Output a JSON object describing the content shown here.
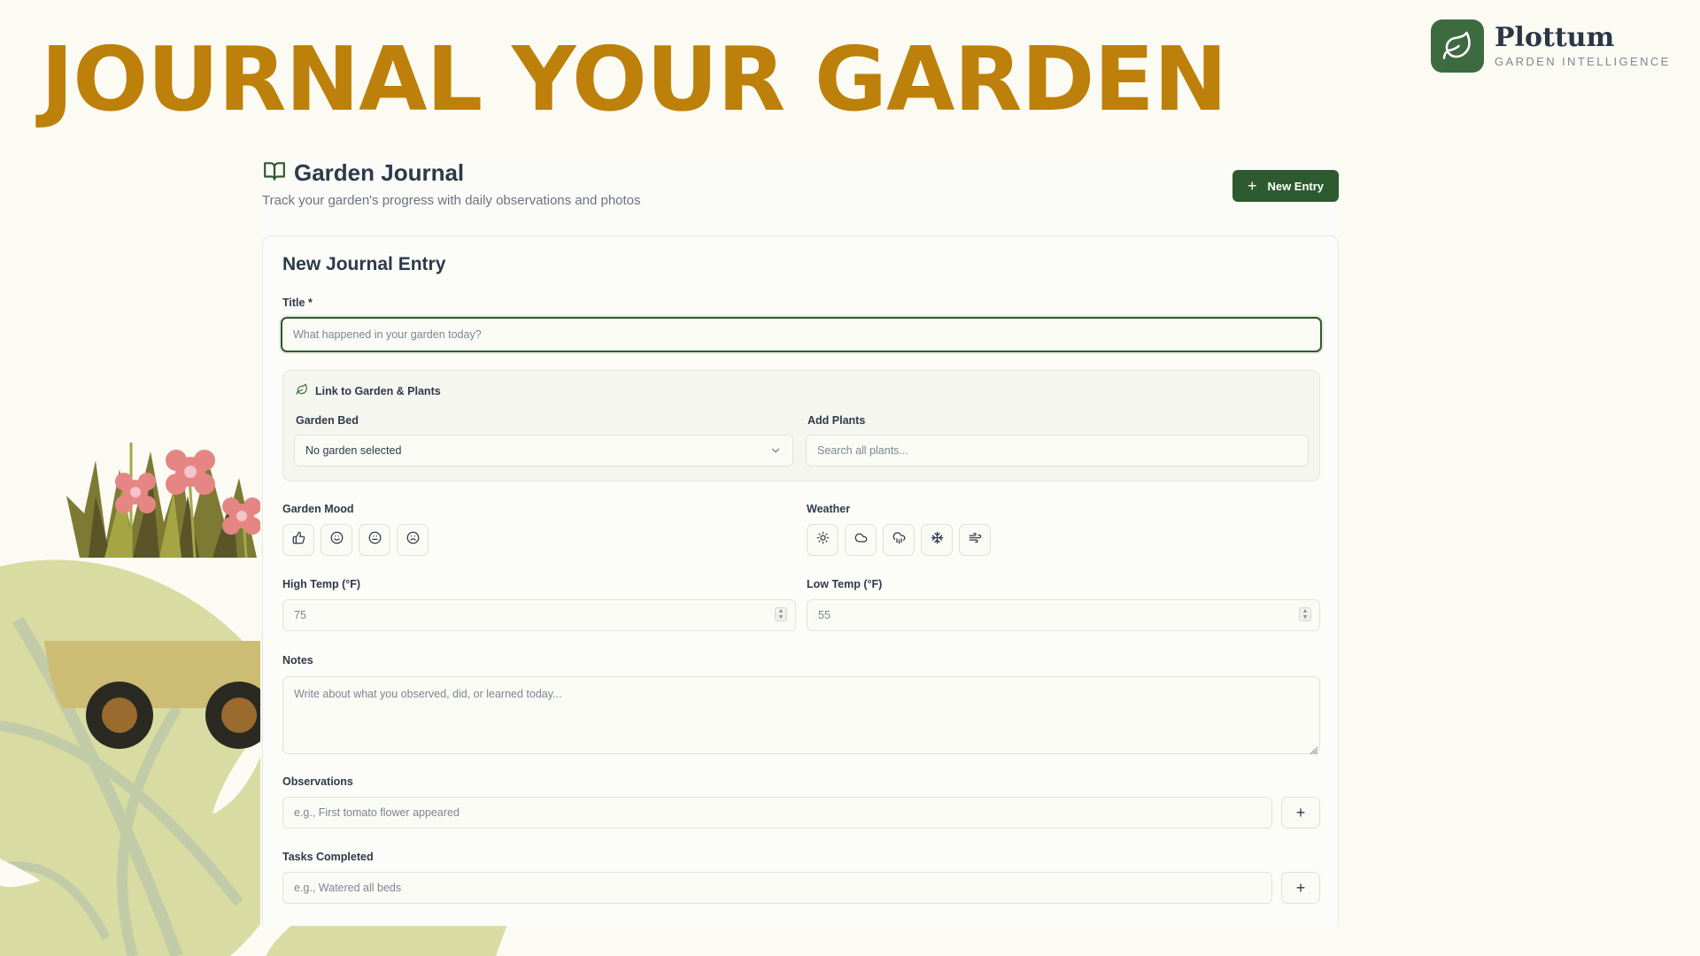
{
  "headline": "JOURNAL YOUR GARDEN",
  "brand": {
    "name": "Plottum",
    "tagline": "GARDEN INTELLIGENCE",
    "color": "#3e6a3f"
  },
  "colors": {
    "accent": "#bd800a",
    "primary": "#2e5a30",
    "background": "#fbfbf3"
  },
  "header": {
    "title": "Garden Journal",
    "subtitle": "Track your garden's progress with daily observations and photos",
    "title_icon": "book-open-icon",
    "new_entry_label": "New Entry"
  },
  "form": {
    "heading": "New Journal Entry",
    "title_label": "Title *",
    "title_placeholder": "What happened in your garden today?",
    "link_section": {
      "label": "Link to Garden & Plants",
      "icon": "leaf-icon",
      "garden_bed_label": "Garden Bed",
      "garden_bed_value": "No garden selected",
      "add_plants_label": "Add Plants",
      "add_plants_placeholder": "Search all plants..."
    },
    "mood": {
      "label": "Garden Mood",
      "options": [
        "thumbs-up-icon",
        "smile-icon",
        "neutral-face-icon",
        "frown-icon"
      ]
    },
    "weather": {
      "label": "Weather",
      "options": [
        "sun-icon",
        "cloud-icon",
        "cloud-rain-icon",
        "snowflake-icon",
        "wind-icon"
      ]
    },
    "high_temp": {
      "label": "High Temp (°F)",
      "placeholder": "75"
    },
    "low_temp": {
      "label": "Low Temp (°F)",
      "placeholder": "55"
    },
    "notes": {
      "label": "Notes",
      "placeholder": "Write about what you observed, did, or learned today..."
    },
    "observations": {
      "label": "Observations",
      "placeholder": "e.g., First tomato flower appeared",
      "add_label": "+"
    },
    "tasks": {
      "label": "Tasks Completed",
      "placeholder": "e.g., Watered all beds",
      "add_label": "+"
    }
  }
}
